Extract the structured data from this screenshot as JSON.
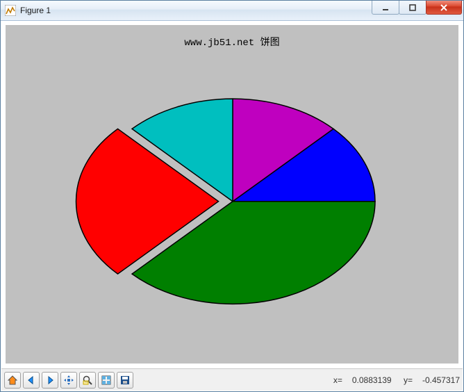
{
  "window": {
    "title": "Figure 1"
  },
  "chart_data": {
    "type": "pie",
    "title": "www.jb51.net 饼图",
    "series": [
      {
        "name": "blue",
        "value": 12.5,
        "color": "#0000ff",
        "explode": 0
      },
      {
        "name": "magenta",
        "value": 12.5,
        "color": "#bf00bf",
        "explode": 0
      },
      {
        "name": "cyan",
        "value": 12.5,
        "color": "#00bfbf",
        "explode": 0
      },
      {
        "name": "red",
        "value": 25.0,
        "color": "#ff0000",
        "explode": 0.1
      },
      {
        "name": "green",
        "value": 37.5,
        "color": "#007f00",
        "explode": 0
      }
    ],
    "startangle": 0,
    "aspect_y_over_x": 0.72
  },
  "statusbar": {
    "x": "0.0883139",
    "y": "-0.457317"
  },
  "toolbar": {
    "home": "Home",
    "back": "Back",
    "forward": "Forward",
    "pan": "Pan",
    "zoom": "Zoom",
    "subplots": "Configure subplots",
    "save": "Save"
  }
}
